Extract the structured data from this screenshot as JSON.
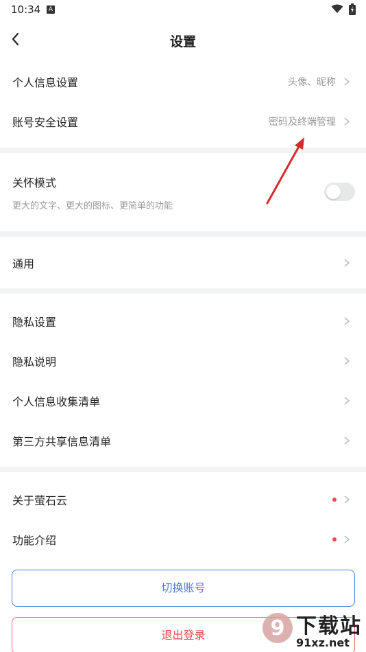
{
  "status_bar": {
    "time": "10:34",
    "notif_badge": "A"
  },
  "header": {
    "title": "设置"
  },
  "groups": {
    "profile": [
      {
        "label": "个人信息设置",
        "value": "头像、昵称"
      },
      {
        "label": "账号安全设置",
        "value": "密码及终端管理"
      }
    ],
    "care": {
      "label": "关怀模式",
      "description": "更大的文字、更大的图标、更简单的功能",
      "enabled": false
    },
    "general": [
      {
        "label": "通用"
      }
    ],
    "privacy": [
      {
        "label": "隐私设置"
      },
      {
        "label": "隐私说明"
      },
      {
        "label": "个人信息收集清单"
      },
      {
        "label": "第三方共享信息清单"
      }
    ],
    "about": [
      {
        "label": "关于萤石云",
        "has_dot": true
      },
      {
        "label": "功能介绍",
        "has_dot": true
      }
    ]
  },
  "buttons": {
    "switch_account": "切换账号",
    "logout": "退出登录"
  },
  "watermark": {
    "text": "下载站",
    "url": "91xz.net",
    "logo_number": "9"
  },
  "colors": {
    "accent_blue": "#4a7bd8",
    "danger_red": "#e84a4a",
    "dot_red": "#ef4a4a",
    "divider": "#f2f3f5"
  }
}
